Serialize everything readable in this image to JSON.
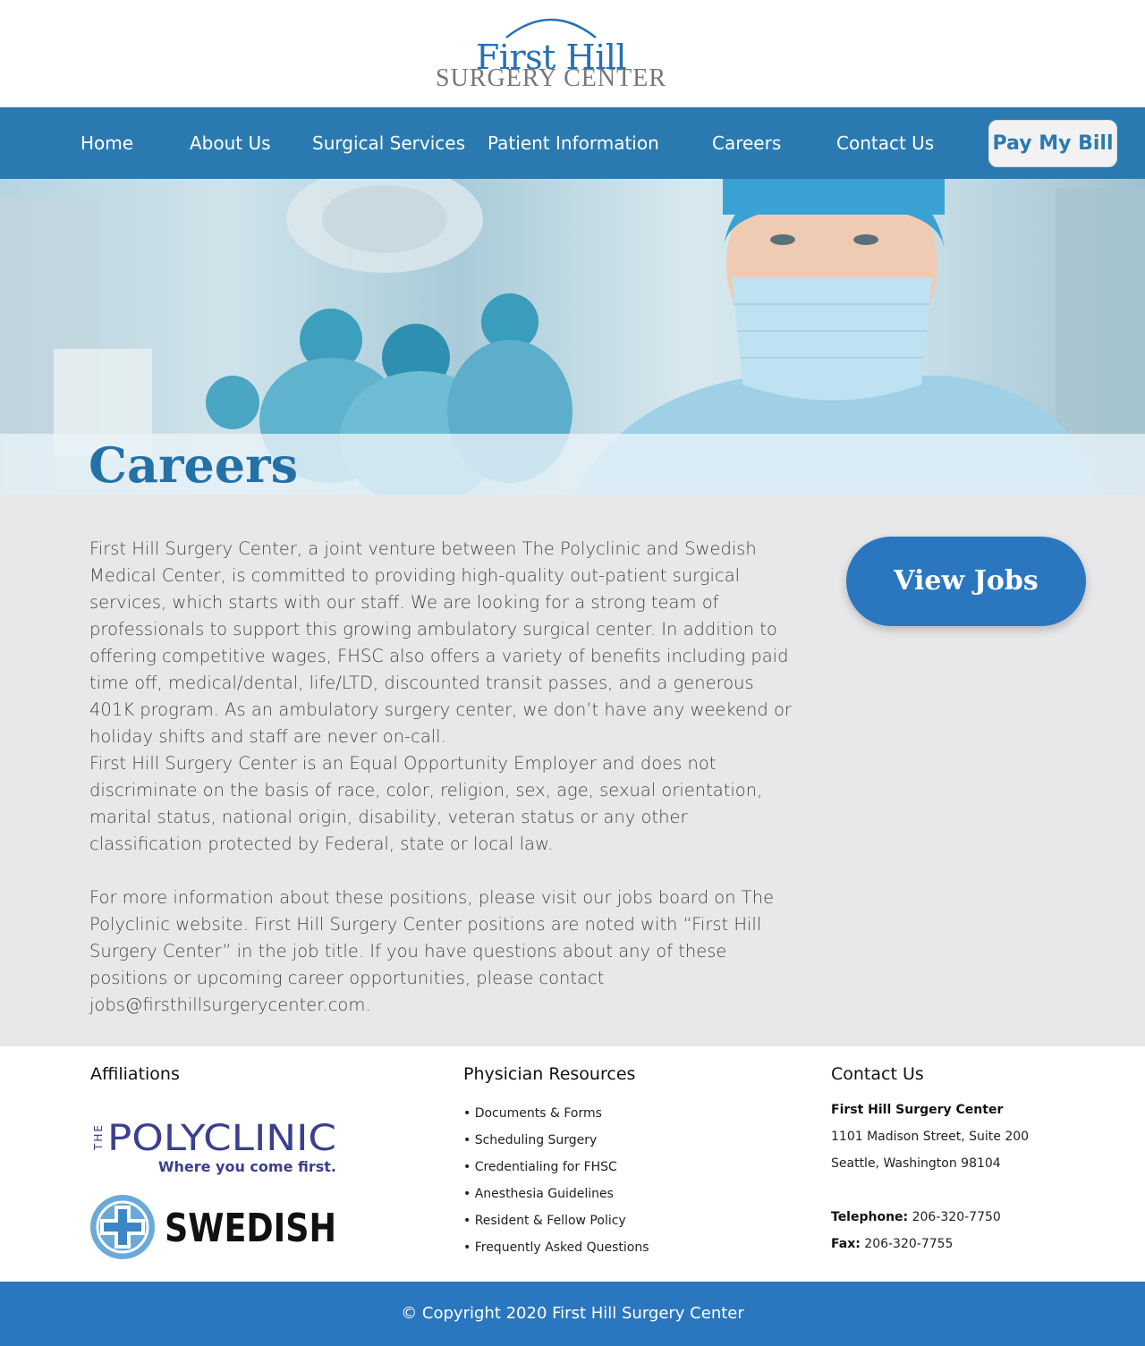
{
  "brand": {
    "line1": "First Hill",
    "line2": "SURGERY CENTER",
    "primary_color": "#2a7ab1",
    "accent_color": "#2a77c0"
  },
  "nav": {
    "items": [
      "Home",
      "About Us",
      "Surgical Services",
      "Patient Information",
      "Careers",
      "Contact Us"
    ],
    "pay_button": "Pay My Bill"
  },
  "hero": {
    "title": "Careers"
  },
  "main": {
    "paragraphs": [
      "First Hill Surgery Center, a joint venture between The Polyclinic and Swedish Medical Center, is committed to providing high-quality out-patient surgical services, which starts with our staff. We are looking for a strong team of professionals to support this growing ambulatory surgical center. In addition to offering competitive wages, FHSC also offers a variety of benefits including paid time off, medical/dental, life/LTD, discounted transit passes, and a generous 401K program. As an ambulatory surgery center, we don’t have any weekend or holiday shifts and staff are never on-call.",
      "First Hill Surgery Center is an Equal Opportunity Employer and does not discriminate on the basis of race, color, religion, sex, age, sexual orientation, marital status, national origin, disability, veteran status or any other classification protected by Federal, state or local law.",
      "For more information about these positions, please visit our jobs board on The Polyclinic website. First Hill Surgery Center positions are noted with “First Hill Surgery Center” in the job title. If you have questions about any of these positions or upcoming career opportunities, please contact jobs@firsthillsurgerycenter.com."
    ],
    "view_jobs_label": "View Jobs"
  },
  "footer": {
    "affiliations": {
      "title": "Affiliations",
      "polyclinic_the": "THE",
      "polyclinic_name": "POLYCLINIC",
      "polyclinic_tagline": "Where you come first.",
      "swedish_name": "SWEDISH"
    },
    "physician_resources": {
      "title": "Physician Resources",
      "items": [
        "• Documents & Forms",
        "• Scheduling Surgery",
        "• Credentialing for FHSC",
        "• Anesthesia Guidelines",
        "• Resident & Fellow Policy",
        "• Frequently Asked Questions"
      ]
    },
    "contact": {
      "title": "Contact Us",
      "org": "First Hill Surgery Center",
      "address1": "1101 Madison Street, Suite 200",
      "address2": "Seattle, Washington 98104",
      "telephone_label": "Telephone:",
      "telephone": "206-320-7750",
      "fax_label": "Fax:",
      "fax": "206-320-7755"
    },
    "copyright": "© Copyright 2020 First Hill Surgery Center"
  }
}
